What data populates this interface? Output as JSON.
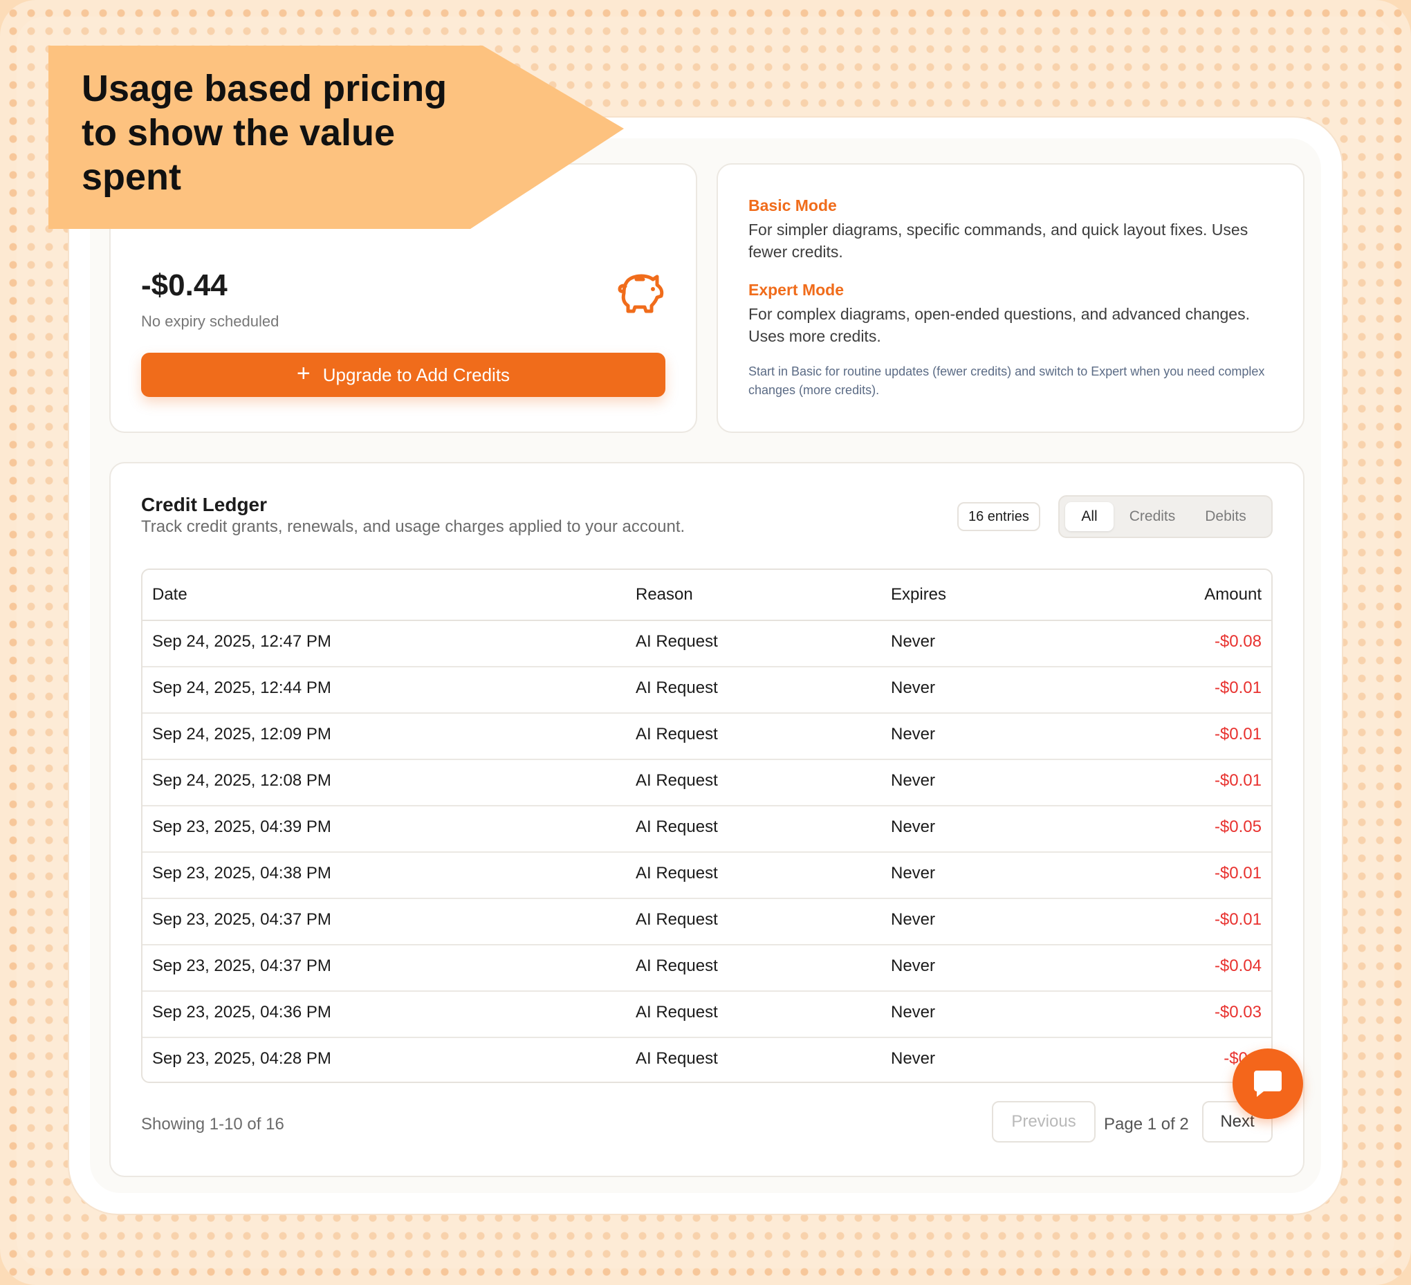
{
  "banner": {
    "text": "Usage based pricing to show the value spent"
  },
  "balance": {
    "amount": "-$0.44",
    "expiry": "No expiry scheduled",
    "upgrade_icon": "plus-icon",
    "upgrade_label": "Upgrade to Add Credits",
    "icon": "piggy-bank-icon"
  },
  "modes": {
    "basic_title": "Basic Mode",
    "basic_desc": "For simpler diagrams, specific commands, and quick layout fixes. Uses fewer credits.",
    "expert_title": "Expert Mode",
    "expert_desc": "For complex diagrams, open-ended questions, and advanced changes. Uses more credits.",
    "hint": "Start in Basic for routine updates (fewer credits) and switch to Expert when you need complex changes (more credits)."
  },
  "ledger": {
    "title": "Credit Ledger",
    "subtitle": "Track credit grants, renewals, and usage charges applied to your account.",
    "entries_badge": "16 entries",
    "filters": [
      "All",
      "Credits",
      "Debits"
    ],
    "active_filter": "All",
    "columns": {
      "date": "Date",
      "reason": "Reason",
      "expires": "Expires",
      "amount": "Amount"
    },
    "rows": [
      {
        "date": "Sep 24, 2025, 12:47 PM",
        "reason": "AI Request",
        "expires": "Never",
        "amount": "-$0.08"
      },
      {
        "date": "Sep 24, 2025, 12:44 PM",
        "reason": "AI Request",
        "expires": "Never",
        "amount": "-$0.01"
      },
      {
        "date": "Sep 24, 2025, 12:09 PM",
        "reason": "AI Request",
        "expires": "Never",
        "amount": "-$0.01"
      },
      {
        "date": "Sep 24, 2025, 12:08 PM",
        "reason": "AI Request",
        "expires": "Never",
        "amount": "-$0.01"
      },
      {
        "date": "Sep 23, 2025, 04:39 PM",
        "reason": "AI Request",
        "expires": "Never",
        "amount": "-$0.05"
      },
      {
        "date": "Sep 23, 2025, 04:38 PM",
        "reason": "AI Request",
        "expires": "Never",
        "amount": "-$0.01"
      },
      {
        "date": "Sep 23, 2025, 04:37 PM",
        "reason": "AI Request",
        "expires": "Never",
        "amount": "-$0.01"
      },
      {
        "date": "Sep 23, 2025, 04:37 PM",
        "reason": "AI Request",
        "expires": "Never",
        "amount": "-$0.04"
      },
      {
        "date": "Sep 23, 2025, 04:36 PM",
        "reason": "AI Request",
        "expires": "Never",
        "amount": "-$0.03"
      },
      {
        "date": "Sep 23, 2025, 04:28 PM",
        "reason": "AI Request",
        "expires": "Never",
        "amount": "-$0.0"
      }
    ],
    "showing": "Showing 1-10 of 16",
    "prev_label": "Previous",
    "page_info": "Page 1 of 2",
    "next_label": "Next"
  },
  "colors": {
    "accent": "#f06c1b",
    "negative": "#e8322f",
    "banner": "#fdc27f"
  },
  "chat": {
    "icon": "chat-bubble-icon"
  }
}
